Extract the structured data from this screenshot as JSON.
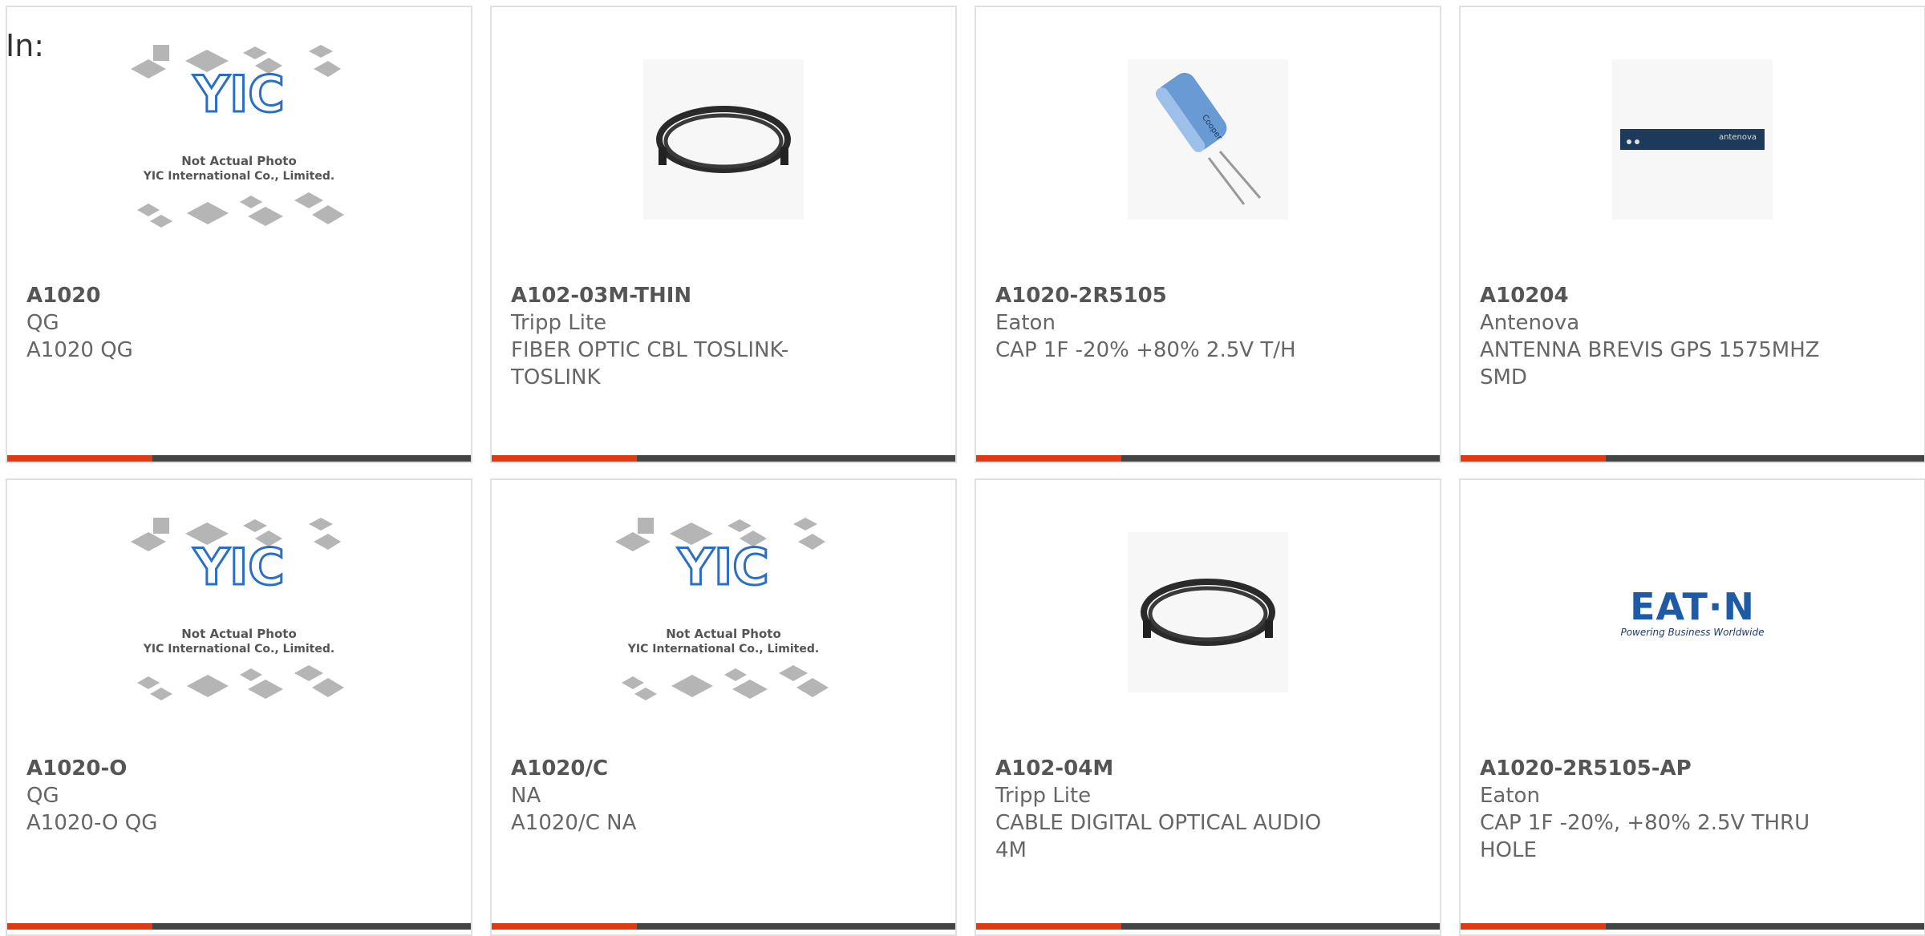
{
  "header": {
    "label": "In:"
  },
  "placeholder_image": {
    "line1": "Not Actual Photo",
    "line2": "YIC International Co., Limited.",
    "logo_text": "YIC"
  },
  "antenna_image": {
    "label": "antenova"
  },
  "eaton_image": {
    "word": "EAT·N",
    "tagline": "Powering Business Worldwide"
  },
  "colors": {
    "accent": "#e03a14",
    "bar": "#444444",
    "text": "#666666",
    "border": "#e0e0e0"
  },
  "products": [
    {
      "part": "A1020",
      "manufacturer": "QG",
      "description": "A1020 QG",
      "image": "yic-placeholder-icon"
    },
    {
      "part": "A102-03M-THIN",
      "manufacturer": "Tripp Lite",
      "description": "FIBER OPTIC CBL TOSLINK-TOSLINK",
      "image": "optical-cable-icon"
    },
    {
      "part": "A1020-2R5105",
      "manufacturer": "Eaton",
      "description": "CAP 1F -20% +80% 2.5V T/H",
      "image": "capacitor-icon"
    },
    {
      "part": "A10204",
      "manufacturer": "Antenova",
      "description": "ANTENNA BREVIS GPS 1575MHZ SMD",
      "image": "antenna-board-icon"
    },
    {
      "part": "A1020-O",
      "manufacturer": "QG",
      "description": "A1020-O QG",
      "image": "yic-placeholder-icon"
    },
    {
      "part": "A1020/C",
      "manufacturer": "NA",
      "description": "A1020/C NA",
      "image": "yic-placeholder-icon"
    },
    {
      "part": "A102-04M",
      "manufacturer": "Tripp Lite",
      "description": "CABLE DIGITAL OPTICAL AUDIO 4M",
      "image": "optical-cable-icon"
    },
    {
      "part": "A1020-2R5105-AP",
      "manufacturer": "Eaton",
      "description": "CAP 1F -20%, +80% 2.5V THRU HOLE",
      "image": "eaton-logo-icon"
    }
  ]
}
